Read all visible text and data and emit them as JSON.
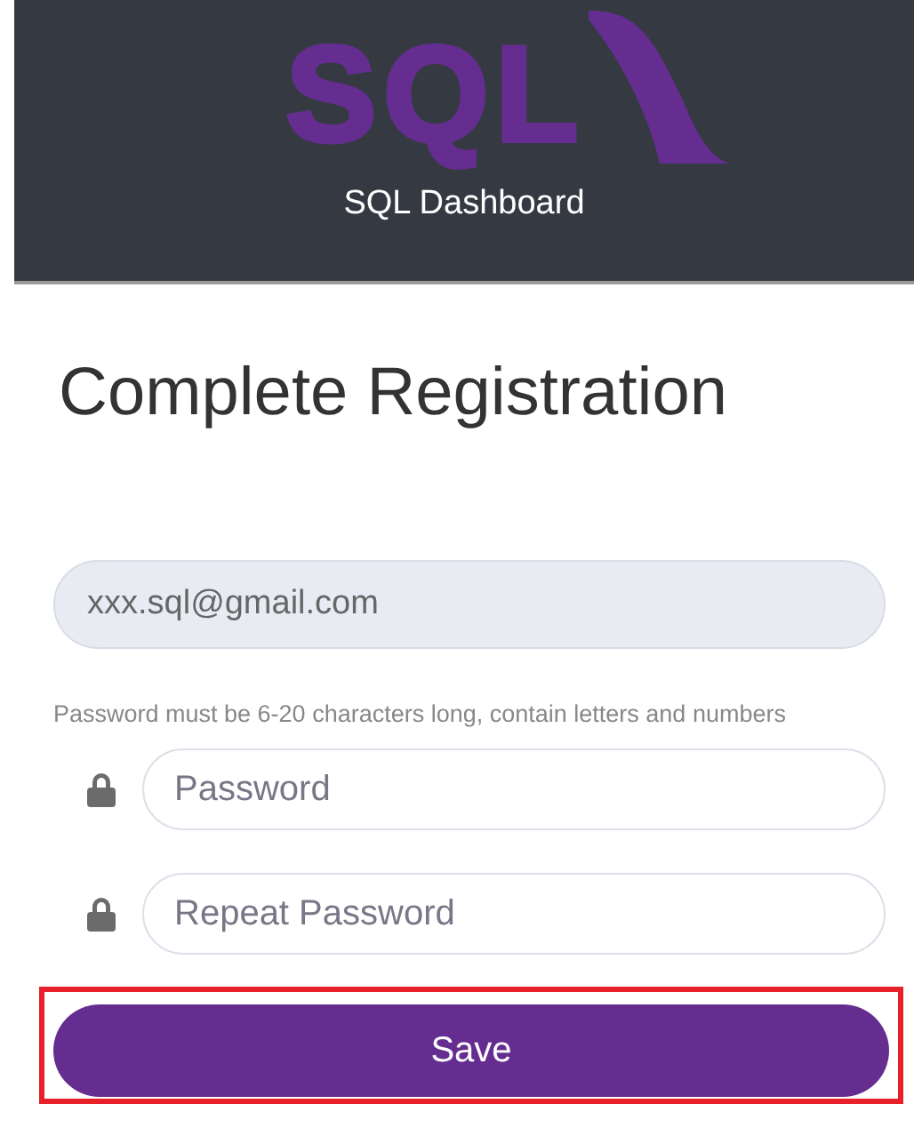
{
  "header": {
    "logo_text": "SQL",
    "title": "SQL Dashboard"
  },
  "form": {
    "heading": "Complete Registration",
    "email": {
      "value": "xxx.sql@gmail.com",
      "disabled": true
    },
    "hint": "Password must be 6-20 characters long, contain letters and numbers",
    "password_fields": [
      {
        "placeholder": "Password"
      },
      {
        "placeholder": "Repeat Password"
      }
    ],
    "save_button": {
      "label": "Save",
      "highlighted": true
    }
  }
}
